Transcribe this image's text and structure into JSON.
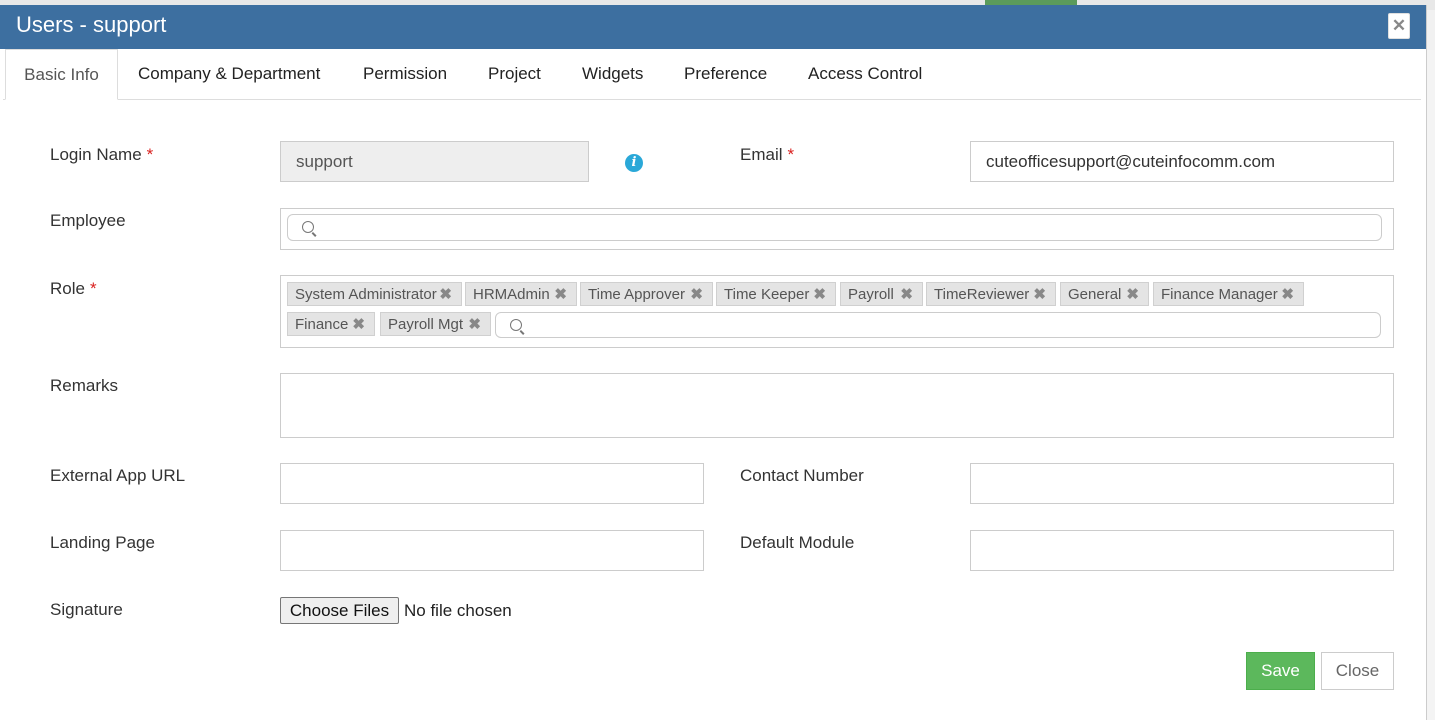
{
  "modal": {
    "title": "Users - support",
    "close_glyph": "✕"
  },
  "tabs": [
    "Basic Info",
    "Company & Department",
    "Permission",
    "Project",
    "Widgets",
    "Preference",
    "Access Control"
  ],
  "form": {
    "required_mark": "*",
    "login_name": {
      "label": "Login Name",
      "value": "support"
    },
    "email": {
      "label": "Email",
      "value": "cuteofficesupport@cuteinfocomm.com"
    },
    "employee": {
      "label": "Employee"
    },
    "role": {
      "label": "Role",
      "selected": [
        "System Administrator",
        "HRMAdmin",
        "Time Approver",
        "Time Keeper",
        "Payroll",
        "TimeReviewer",
        "General",
        "Finance Manager",
        "Finance",
        "Payroll Mgt"
      ]
    },
    "remarks": {
      "label": "Remarks",
      "value": ""
    },
    "external_app_url": {
      "label": "External App URL",
      "value": ""
    },
    "contact_number": {
      "label": "Contact Number",
      "value": ""
    },
    "landing_page": {
      "label": "Landing Page",
      "value": ""
    },
    "default_module": {
      "label": "Default Module",
      "value": ""
    },
    "signature": {
      "label": "Signature",
      "button": "Choose Files",
      "status": "No file chosen"
    }
  },
  "buttons": {
    "save": "Save",
    "close": "Close"
  },
  "colors": {
    "header": "#3d6fa0",
    "save": "#5cb85c",
    "required": "#d9201e",
    "info": "#2aa8d8"
  },
  "icons": {
    "info": "i",
    "chip_remove": "✖"
  }
}
